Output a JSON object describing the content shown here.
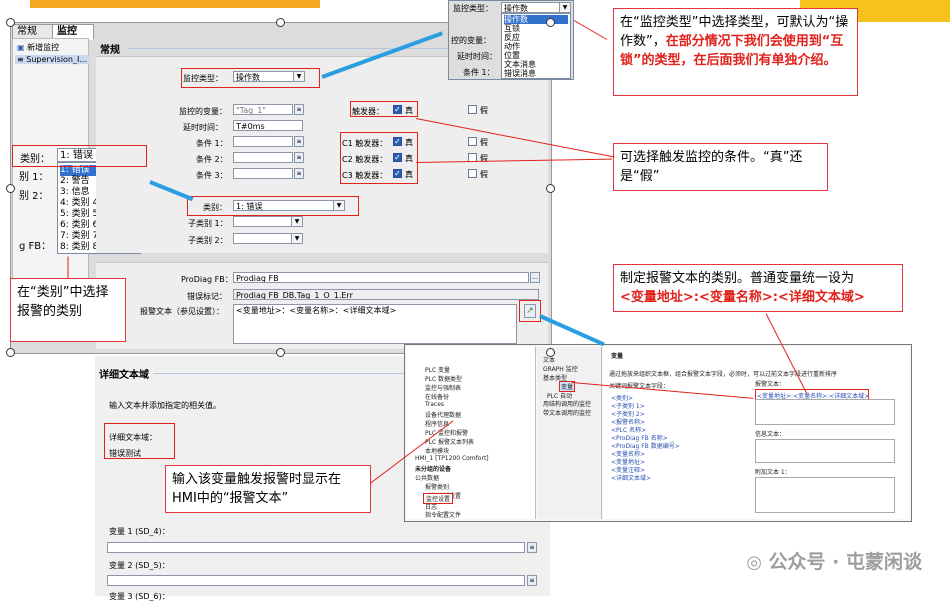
{
  "tabs": [
    "常规",
    "监控"
  ],
  "tree": {
    "add_label": "新增监控",
    "item_label": "Supervision_I..."
  },
  "main": {
    "section_title": "常规",
    "monitor_type_label": "监控类型：",
    "monitor_type_value": "操作数",
    "watched_var_label": "监控的变量：",
    "watched_var_value": "\"Tag_1\"",
    "delay_label": "延时时间：",
    "delay_value": "T#0ms",
    "cond1_label": "条件 1：",
    "cond2_label": "条件 2：",
    "cond3_label": "条件 3：",
    "trigger_label": "触发器：",
    "c1_label": "C1 触发器：",
    "c2_label": "C2 触发器：",
    "c3_label": "C3 触发器：",
    "true_label": "真",
    "false_label": "假",
    "category_label": "类别：",
    "category_value": "1: 错误",
    "subcat1_label": "子类别 1：",
    "subcat2_label": "子类别 2：",
    "prodiag_fb_label": "ProDiag FB：",
    "prodiag_fb_value": "Prodiag FB",
    "error_mark_label": "错误标记：",
    "error_mark_value": "Prodiag FB_DB.Tag_1_O_1.Err",
    "alarm_text_label": "报警文本（参见设置）：",
    "alarm_text_value": "<变量地址>：<变量名称>：<详细文本域>"
  },
  "left_partial": {
    "cat_label": "类别：",
    "cat_value": "1: 错误",
    "sub1": "别 1：",
    "sub2": "别 2：",
    "fb": "g FB："
  },
  "category_dropdown": [
    "1: 错误",
    "2: 警告",
    "3: 信息",
    "4: 类别 4",
    "5: 类别 5",
    "6: 类别 6",
    "7: 类别 7",
    "8: 类别 8"
  ],
  "type_popup": {
    "labels": [
      "监控类型：",
      "控的变量：",
      "延时时间：",
      "条件 1："
    ],
    "value": "操作数",
    "options": [
      "操作数",
      "互锁",
      "反应",
      "动作",
      "位置",
      "文本消息",
      "错误消息"
    ]
  },
  "callouts": {
    "c1_a": "在“监控类型”中选择类型，可默认为“操作数”，",
    "c1_b": "在部分情况下我们会使用到“互锁”的类型，在后面我们有单独介绍。",
    "c2": "可选择触发监控的条件。“真”还是“假”",
    "c3": "在“类别”中选择报警的类别",
    "c4_a": "制定报警文本的类别。普通变量统一设为",
    "c4_b": "<变量地址>:<变量名称>:<详细文本域>",
    "c5": "输入该变量触发报警时显示在HMI中的“报警文本”"
  },
  "bottom": {
    "title": "详细文本域",
    "hint": "输入文本并添加指定的相关值。",
    "field_label": "详细文本域：",
    "field_value": "错误测试",
    "var1": "变量 1 (SD_4)：",
    "var2": "变量 2 (SD_5)：",
    "var3": "变量 3 (SD_6)："
  },
  "inset": {
    "tree": [
      "PLC 变量",
      "PLC 数据类型",
      "监控与强制表",
      "在线备份",
      "Traces",
      "设备代理数据",
      "程序信息",
      "PLC 监控和报警",
      "PLC 报警文本列表",
      "本地模块",
      "HMI_1 [TP1200 Comfort]",
      "未分组的设备",
      "公共数据",
      "报警类别",
      "系统诊断设置",
      "监控设置",
      "日志",
      "指令配置文件",
      "样式"
    ],
    "nav": [
      "文本",
      "GRAPH 监控",
      "基本类型",
      "变量",
      "PLC 自动",
      "用结构调用的监控",
      "带文本调用的监控"
    ],
    "header": "变量",
    "desc": "通过拖放来组织文本框，组合报警文本字段，必须时，可以过前文本字段进行重新排序",
    "keywords_label": "关键词报警文本字段：",
    "keywords": [
      "<类别>",
      "<子类别 1>",
      "<子类别 2>",
      "<报警名称>",
      "<PLC 名称>",
      "<ProDiag FB 名称>",
      "<ProDiag FB 数据编号>",
      "<变量名称>",
      "<变量地址>",
      "<变量注释>",
      "<详细文本域>"
    ],
    "alarm_text_label": "报警文本：",
    "alarm_text_value": "<变量地址>:<变量名称>:<详细文本域>",
    "info_label": "信息文本：",
    "extra_label": "附加文本 1："
  },
  "watermark": "公众号 · 屯蒙闲谈",
  "colors": {
    "accent_blue": "#2a9ee0",
    "callout_red": "#e1221c",
    "highlight": "#3271cc"
  }
}
